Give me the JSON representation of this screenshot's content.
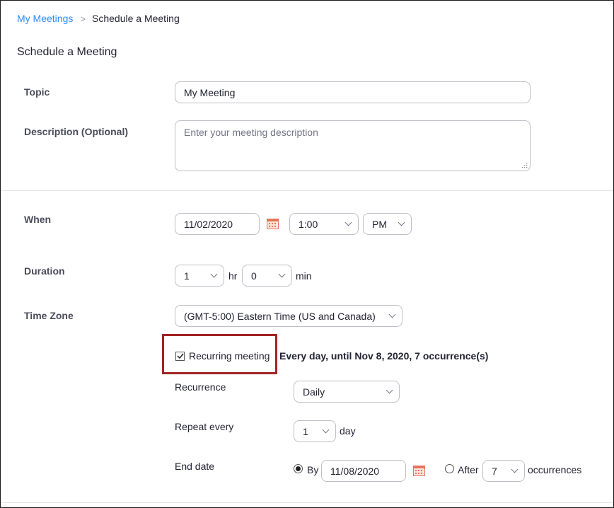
{
  "breadcrumb": {
    "parent": "My Meetings",
    "separator": ">",
    "current": "Schedule a Meeting"
  },
  "page_title": "Schedule a Meeting",
  "topic": {
    "label": "Topic",
    "value": "My Meeting"
  },
  "description": {
    "label": "Description (Optional)",
    "placeholder": "Enter your meeting description"
  },
  "when": {
    "label": "When",
    "date": "11/02/2020",
    "time": "1:00",
    "ampm": "PM"
  },
  "duration": {
    "label": "Duration",
    "hours": "1",
    "hours_unit": "hr",
    "minutes": "0",
    "minutes_unit": "min"
  },
  "timezone": {
    "label": "Time Zone",
    "value": "(GMT-5:00) Eastern Time (US and Canada)"
  },
  "recurring": {
    "label": "Recurring meeting",
    "checked": true,
    "summary": "Every day, until Nov 8, 2020, 7 occurrence(s)"
  },
  "recurrence": {
    "label": "Recurrence",
    "value": "Daily"
  },
  "repeat_every": {
    "label": "Repeat every",
    "value": "1",
    "unit": "day"
  },
  "end_date": {
    "label": "End date",
    "by_label": "By",
    "by_date": "11/08/2020",
    "after_label": "After",
    "after_count": "7",
    "occurrences_label": "occurrences",
    "selected": "by"
  },
  "colors": {
    "link": "#2d8cff",
    "highlight": "#a32326",
    "calendar_icon": "#e8735a"
  },
  "icons": {
    "calendar": "calendar-icon",
    "dropdown": "chevron-down-icon"
  }
}
